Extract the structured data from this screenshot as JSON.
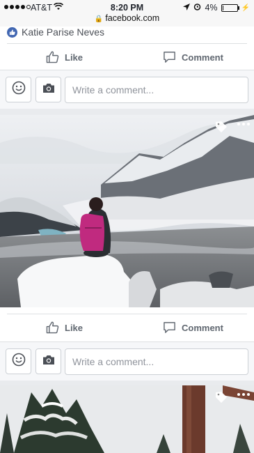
{
  "status_bar": {
    "carrier": "AT&T",
    "time": "8:20 PM",
    "battery": "4%",
    "battery_level": 0.04,
    "url": "facebook.com"
  },
  "post1": {
    "liked_by": "Katie Parise Neves",
    "like_label": "Like",
    "comment_label": "Comment",
    "comment_placeholder": "Write a comment..."
  },
  "post2": {
    "like_label": "Like",
    "comment_label": "Comment",
    "comment_placeholder": "Write a comment..."
  },
  "icons": [
    "signal-icon",
    "wifi-icon",
    "lock-icon",
    "location-icon",
    "alarm-icon",
    "battery-icon",
    "like-icon",
    "thumbs-up-icon",
    "comment-icon",
    "emoji-icon",
    "camera-icon",
    "tag-icon",
    "more-icon"
  ],
  "colors": {
    "facebook_blue": "#4267b2",
    "action_gray": "#606770",
    "background": "#e9ebee"
  }
}
